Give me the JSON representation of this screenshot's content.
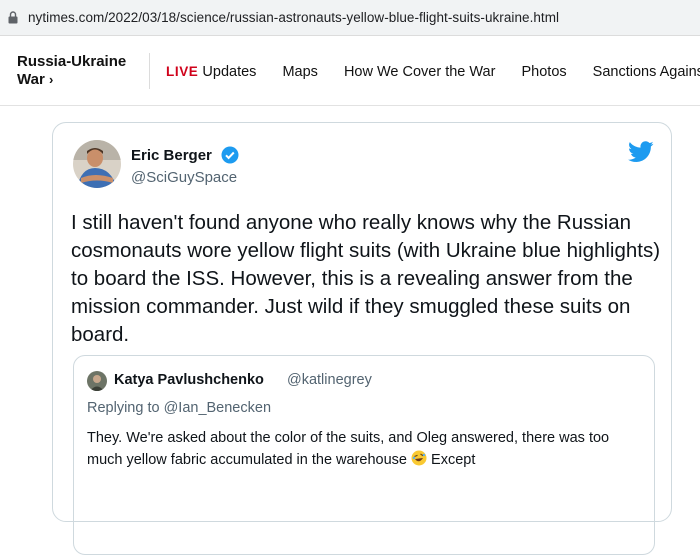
{
  "browser": {
    "url": "nytimes.com/2022/03/18/science/russian-astronauts-yellow-blue-flight-suits-ukraine.html",
    "lock_icon": "lock-icon"
  },
  "nav": {
    "section_title": "Russia-Ukraine War",
    "section_line1": "Russia-Ukraine",
    "section_line2": "War",
    "section_chevron": "›",
    "live_badge": "LIVE",
    "links": [
      "Updates",
      "Maps",
      "How We Cover the War",
      "Photos",
      "Sanctions Against Russia"
    ],
    "live_color": "#d0021b"
  },
  "tweet": {
    "author_name": "Eric Berger",
    "author_handle": "@SciGuySpace",
    "verified_icon": "verified-badge-icon",
    "logo_icon": "twitter-bird-icon",
    "text": "I still haven't found anyone who really knows why the Russian cosmonauts wore yellow flight suits (with Ukraine blue highlights) to board the ISS. However, this is a revealing answer from the mission commander. Just wild if they smuggled these suits on board.",
    "accent_color": "#1d9bf0",
    "quoted": {
      "author_name": "Katya Pavlushchenko",
      "author_handle": "@katlinegrey",
      "replying_to": "Replying to @Ian_Benecken",
      "text_before_emoji": "They. We're asked about the color of the suits, and Oleg answered, there was too much yellow fabric accumulated in the warehouse",
      "emoji": "rolling-on-floor-laughing-emoji",
      "text_after_emoji": " Except"
    }
  }
}
